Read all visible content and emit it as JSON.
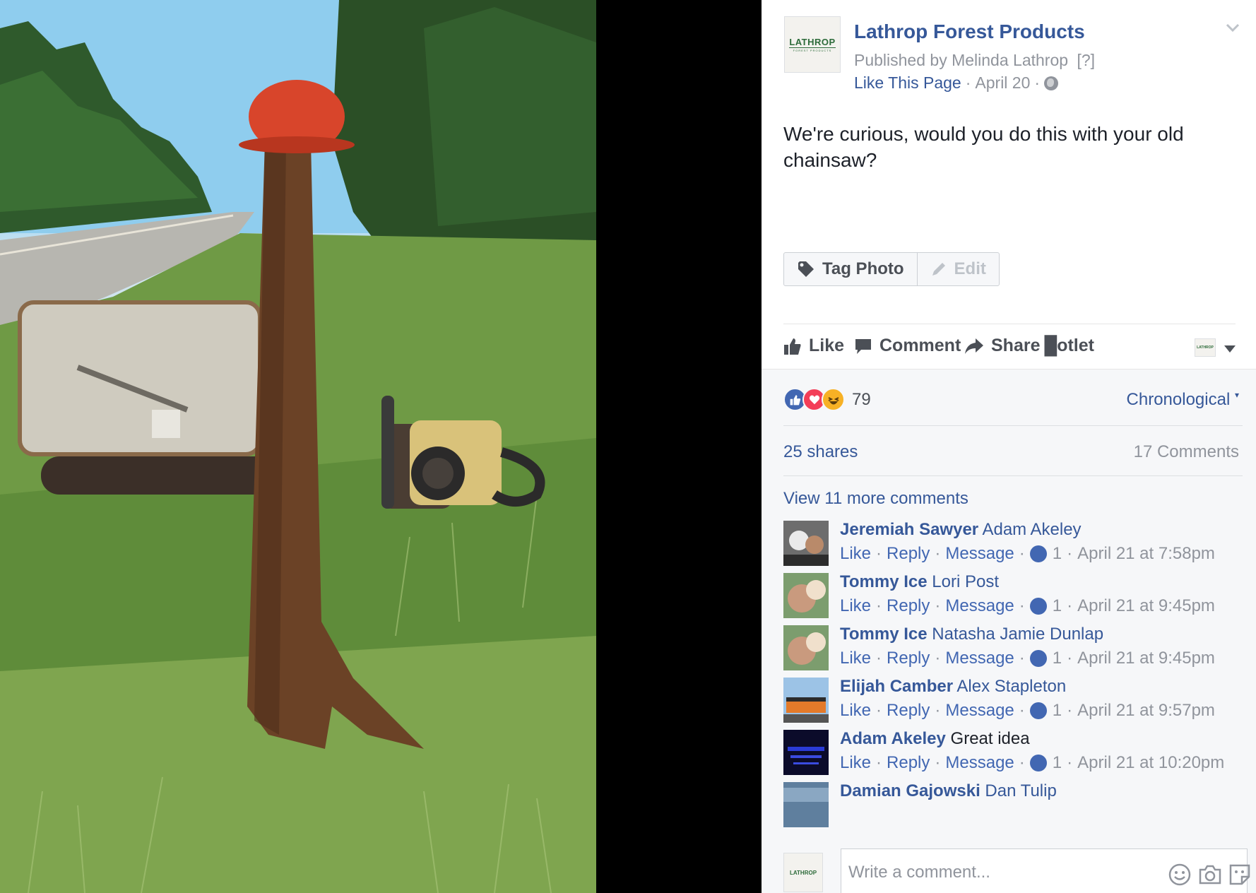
{
  "photo": {
    "description_icon": "photo-mailbox-chainsaw"
  },
  "post": {
    "page_name": "Lathrop Forest Products",
    "logo_text": "LATHROP",
    "logo_subtext": "FOREST PRODUCTS",
    "published_prefix": "Published by Melinda Lathrop",
    "help_marker": "[?]",
    "like_page": "Like This Page",
    "date": "April 20",
    "text": "We're curious, would you do this with your old chainsaw?"
  },
  "photo_actions": {
    "tag_photo": "Tag Photo",
    "edit": "Edit"
  },
  "actions": {
    "like": "Like",
    "comment": "Comment",
    "share": "Share",
    "bootlet": "█otlet"
  },
  "reactions": {
    "count": "79",
    "sort": "Chronological"
  },
  "stats": {
    "shares": "25 shares",
    "comments": "17 Comments",
    "view_more": "View 11 more comments"
  },
  "comment_meta": {
    "like": "Like",
    "reply": "Reply",
    "message": "Message",
    "sep": "·"
  },
  "comments": [
    {
      "author": "Jeremiah Sawyer",
      "text": "Adam Akeley",
      "likes": "1",
      "time": "April 21 at 7:58pm"
    },
    {
      "author": "Tommy Ice",
      "text": "Lori Post",
      "likes": "1",
      "time": "April 21 at 9:45pm"
    },
    {
      "author": "Tommy Ice",
      "text": "Natasha Jamie Dunlap",
      "likes": "1",
      "time": "April 21 at 9:45pm"
    },
    {
      "author": "Elijah Camber",
      "text": "Alex Stapleton",
      "likes": "1",
      "time": "April 21 at 9:57pm"
    },
    {
      "author": "Adam Akeley",
      "text": "Great idea",
      "likes": "1",
      "time": "April 21 at 10:20pm"
    },
    {
      "author": "Damian Gajowski",
      "text": "Dan Tulip"
    }
  ],
  "composer": {
    "placeholder": "Write a comment..."
  },
  "colors": {
    "link": "#365899",
    "accent": "#4267b2",
    "muted": "#90949c"
  }
}
